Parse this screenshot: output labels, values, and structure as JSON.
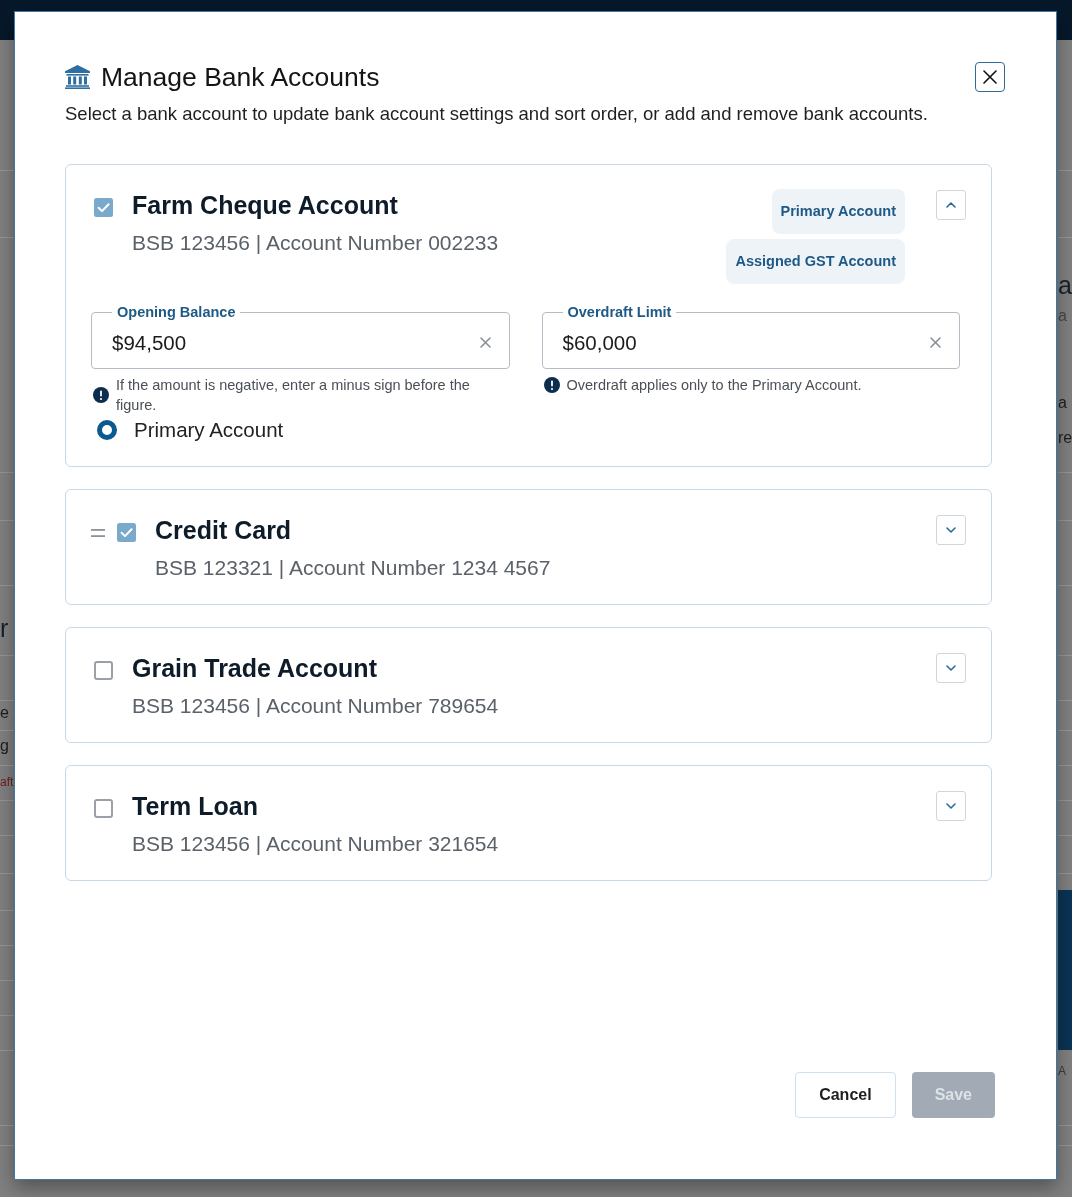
{
  "background_page": {
    "left_edge_texts": [
      {
        "text": "r",
        "kind": "heading"
      },
      {
        "text": "e",
        "kind": "text"
      },
      {
        "text": "g",
        "kind": "text"
      },
      {
        "text": "aft",
        "kind": "alert"
      }
    ],
    "right_edge_texts": [
      {
        "text": "a",
        "kind": "heading"
      },
      {
        "text": "a",
        "kind": "muted"
      },
      {
        "text": "a",
        "kind": "text"
      },
      {
        "text": "re",
        "kind": "text"
      },
      {
        "text": "A",
        "kind": "small"
      }
    ]
  },
  "dialog": {
    "title": "Manage Bank Accounts",
    "description": "Select a bank account to update bank account settings and sort order, or add and remove bank accounts."
  },
  "accounts": [
    {
      "name": "Farm Cheque Account",
      "details": "BSB 123456 | Account Number 002233",
      "checked": true,
      "expanded": true,
      "drag_handle": false,
      "badges": [
        "Primary Account",
        "Assigned GST Account"
      ],
      "fields": [
        {
          "label": "Opening Balance",
          "value": "$94,500",
          "hint": "If the amount is negative, enter a minus sign before the figure."
        },
        {
          "label": "Overdraft Limit",
          "value": "$60,000",
          "hint": "Overdraft applies only to the Primary Account."
        }
      ],
      "primary_radio": {
        "label": "Primary Account",
        "selected": true
      }
    },
    {
      "name": "Credit Card",
      "details": "BSB 123321 | Account Number 1234 4567",
      "checked": true,
      "expanded": false,
      "drag_handle": true
    },
    {
      "name": "Grain Trade Account",
      "details": "BSB 123456 | Account Number 789654",
      "checked": false,
      "expanded": false,
      "drag_handle": false
    },
    {
      "name": "Term Loan",
      "details": "BSB 123456 | Account Number 321654",
      "checked": false,
      "expanded": false,
      "drag_handle": false
    }
  ],
  "buttons": [
    {
      "label": "Cancel",
      "kind": "secondary",
      "disabled": false
    },
    {
      "label": "Save",
      "kind": "primary",
      "disabled": true
    }
  ]
}
